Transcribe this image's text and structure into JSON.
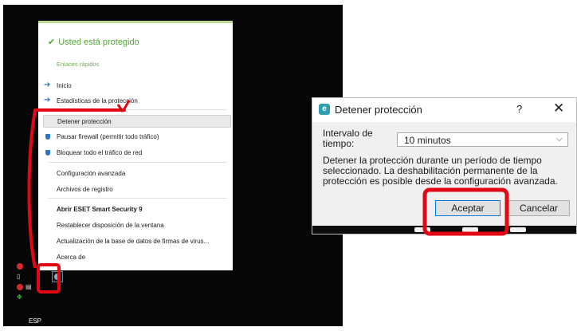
{
  "tray_menu": {
    "status": "Usted está protegido",
    "quick_links_heading": "Enlaces rápidos",
    "items": [
      {
        "label": "Inicio"
      },
      {
        "label": "Estadísticas de la protección"
      },
      {
        "label": "Detener protección"
      },
      {
        "label": "Pausar firewall (permitir todo tráfico)"
      },
      {
        "label": "Bloquear todo el tráfico de red"
      },
      {
        "label": "Configuración avanzada"
      },
      {
        "label": "Archivos de registro"
      },
      {
        "label": "Abrir ESET Smart Security 9"
      },
      {
        "label": "Restablecer disposición de la ventana"
      },
      {
        "label": "Actualización de la base de datos de firmas de virus..."
      },
      {
        "label": "Acerca de"
      }
    ]
  },
  "taskbar": {
    "language": "ESP"
  },
  "dialog": {
    "logo": "e",
    "title": "Detener protección",
    "help": "?",
    "close": "✕",
    "interval_label": "Intervalo de tiempo:",
    "interval_value": "10 minutos",
    "description": "Detener la protección durante un período de tiempo seleccionado. La deshabilitación permanente de la protección es posible desde la configuración avanzada.",
    "accept_label": "Aceptar",
    "cancel_label": "Cancelar"
  },
  "colors": {
    "protected_green": "#52a435",
    "annotation_red": "#e30613",
    "accent_blue": "#0078d7"
  }
}
